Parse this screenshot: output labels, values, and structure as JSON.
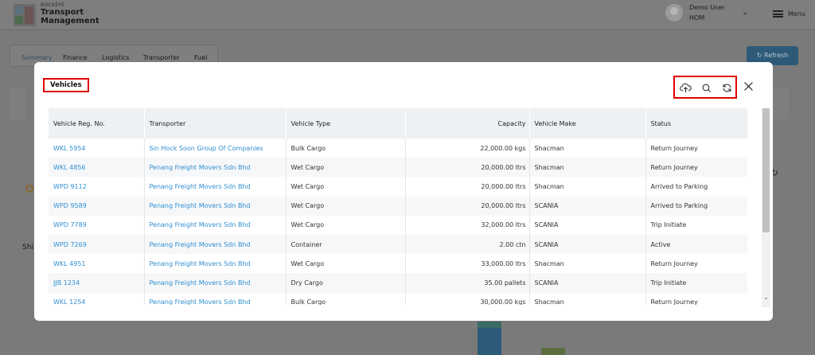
{
  "app": {
    "brand_small": "ROCKEYE",
    "brand_line1": "Transport",
    "brand_line2": "Management",
    "user_name": "Demo User",
    "user_role": "HOM",
    "menu_label": "Menu",
    "refresh_label": "Refresh",
    "tabs": [
      "Summary",
      "Finance",
      "Logistics",
      "Transporter",
      "Fuel"
    ],
    "background_label": "Shi"
  },
  "modal": {
    "title": "Vehicles",
    "actions": [
      "cloud-upload-icon",
      "search-icon",
      "refresh-icon"
    ],
    "columns": {
      "reg": "Vehicle Reg. No.",
      "transporter": "Transporter",
      "type": "Vehicle Type",
      "capacity": "Capacity",
      "make": "Vehicle Make",
      "status": "Status"
    },
    "rows": [
      {
        "reg": "WKL 5954",
        "transporter": "Sin Hock Soon Group Of Companies",
        "type": "Bulk Cargo",
        "capacity": "22,000.00 kgs",
        "make": "Shacman",
        "status": "Return Journey"
      },
      {
        "reg": "WKL 4856",
        "transporter": "Penang Freight Movers Sdn Bhd",
        "type": "Wet Cargo",
        "capacity": "20,000.00 ltrs",
        "make": "Shacman",
        "status": "Return Journey"
      },
      {
        "reg": "WPD 9112",
        "transporter": "Penang Freight Movers Sdn Bhd",
        "type": "Wet Cargo",
        "capacity": "20,000.00 ltrs",
        "make": "Shacman",
        "status": "Arrived to Parking"
      },
      {
        "reg": "WPD 9589",
        "transporter": "Penang Freight Movers Sdn Bhd",
        "type": "Wet Cargo",
        "capacity": "20,000.00 ltrs",
        "make": "SCANIA",
        "status": "Arrived to Parking"
      },
      {
        "reg": "WPD 7789",
        "transporter": "Penang Freight Movers Sdn Bhd",
        "type": "Wet Cargo",
        "capacity": "32,000.00 ltrs",
        "make": "SCANIA",
        "status": "Trip Initiate"
      },
      {
        "reg": "WPD 7269",
        "transporter": "Penang Freight Movers Sdn Bhd",
        "type": "Container",
        "capacity": "2.00 ctn",
        "make": "SCANIA",
        "status": "Active"
      },
      {
        "reg": "WKL 4951",
        "transporter": "Penang Freight Movers Sdn Bhd",
        "type": "Wet Cargo",
        "capacity": "33,000.00 ltrs",
        "make": "Shacman",
        "status": "Return Journey"
      },
      {
        "reg": "JJB 1234",
        "transporter": "Penang Freight Movers Sdn Bhd",
        "type": "Dry Cargo",
        "capacity": "35.00 pallets",
        "make": "SCANIA",
        "status": "Trip Initiate"
      },
      {
        "reg": "WKL 1254",
        "transporter": "Penang Freight Movers Sdn Bhd",
        "type": "Bulk Cargo",
        "capacity": "30,000.00 kgs",
        "make": "Shacman",
        "status": "Return Journey"
      }
    ]
  },
  "colors": {
    "link": "#2f8fd0",
    "highlight": "#e00000",
    "header_bg": "#eef1f4"
  }
}
